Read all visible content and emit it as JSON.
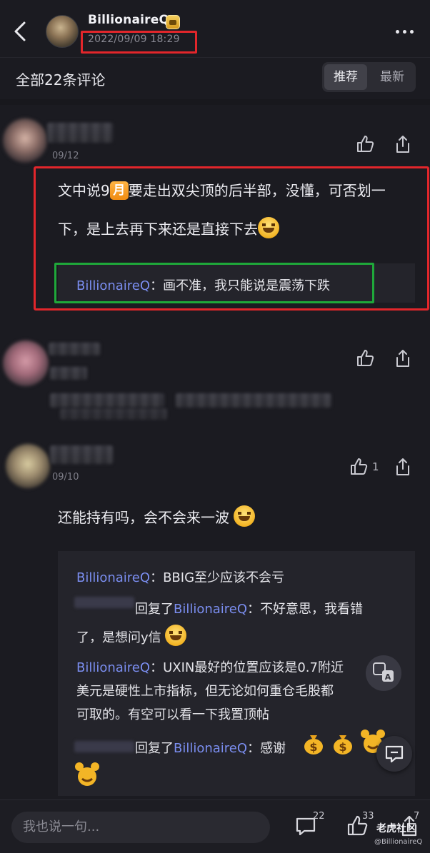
{
  "header": {
    "author_name": "BillionaireQ",
    "post_time": "2022/09/09 18:29"
  },
  "comments_header": {
    "title": "全部22条评论",
    "sort_options": [
      "推荐",
      "最新"
    ],
    "active_sort": "推荐"
  },
  "comments": [
    {
      "date": "09/12",
      "text_parts": [
        "文中说9",
        "月",
        "要走出双尖顶的后半部，没懂，可否划一",
        "下，是上去再下来还是直接下去"
      ],
      "reply": {
        "author": "BillionaireQ",
        "separator": "：",
        "text": "画不准，我只能说是震荡下跌"
      }
    },
    {
      "date": "",
      "text": ""
    },
    {
      "date": "09/10",
      "like_count": "1",
      "text": "还能持有吗，会不会来一波",
      "replies": [
        {
          "author": "BillionaireQ",
          "separator": "：",
          "text": "BBIG至少应该不会亏"
        },
        {
          "prefix": "回复了",
          "author": "BillionaireQ",
          "separator": "：",
          "text": "不好意思，我看错",
          "text2": "了，是想问y信"
        },
        {
          "author": "BillionaireQ",
          "separator": "：",
          "text": "UXIN最好的位置应该是0.7附近",
          "text2": "美元是硬性上市指标，但无论如何重仓毛股都",
          "text3": "可取的。有空可以看一下我置顶帖"
        },
        {
          "prefix": "回复了",
          "author": "BillionaireQ",
          "separator": "：",
          "text": "感谢"
        }
      ]
    }
  ],
  "bottom_bar": {
    "input_placeholder": "我也说一句...",
    "comment_count": "22",
    "like_count": "33",
    "share_count": "7"
  },
  "watermark": {
    "logo_text": "老虎社区",
    "username": "@BillionaireQ"
  },
  "colors": {
    "background": "#1b1b21",
    "reply_author": "#7b8ef0",
    "highlight_red": "#e2262b",
    "highlight_green": "#1fa83a"
  }
}
